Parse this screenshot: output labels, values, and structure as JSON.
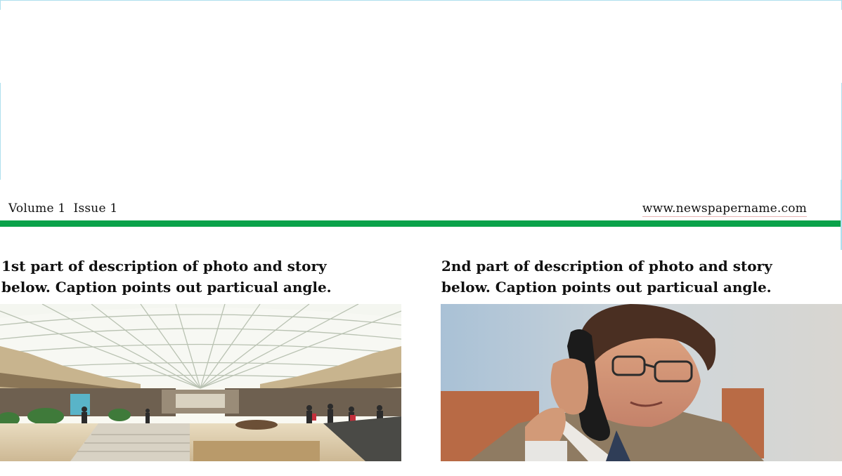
{
  "header": {
    "volume_issue": "Volume 1  Issue 1",
    "website": "www.newspapername.com"
  },
  "stories": [
    {
      "caption_line1": "1st part of description of photo and story",
      "caption_line2": "below. Caption points out particual angle.",
      "photo_subject": "shopping mall atrium with glass skylight roof"
    },
    {
      "caption_line1": "2nd part of description of photo and story",
      "caption_line2": "below. Caption points out particual angle.",
      "photo_subject": "man with glasses talking on a black telephone handset"
    }
  ],
  "colors": {
    "rule": "#0aa24a",
    "frame": "#aee0ee",
    "text": "#111111"
  }
}
